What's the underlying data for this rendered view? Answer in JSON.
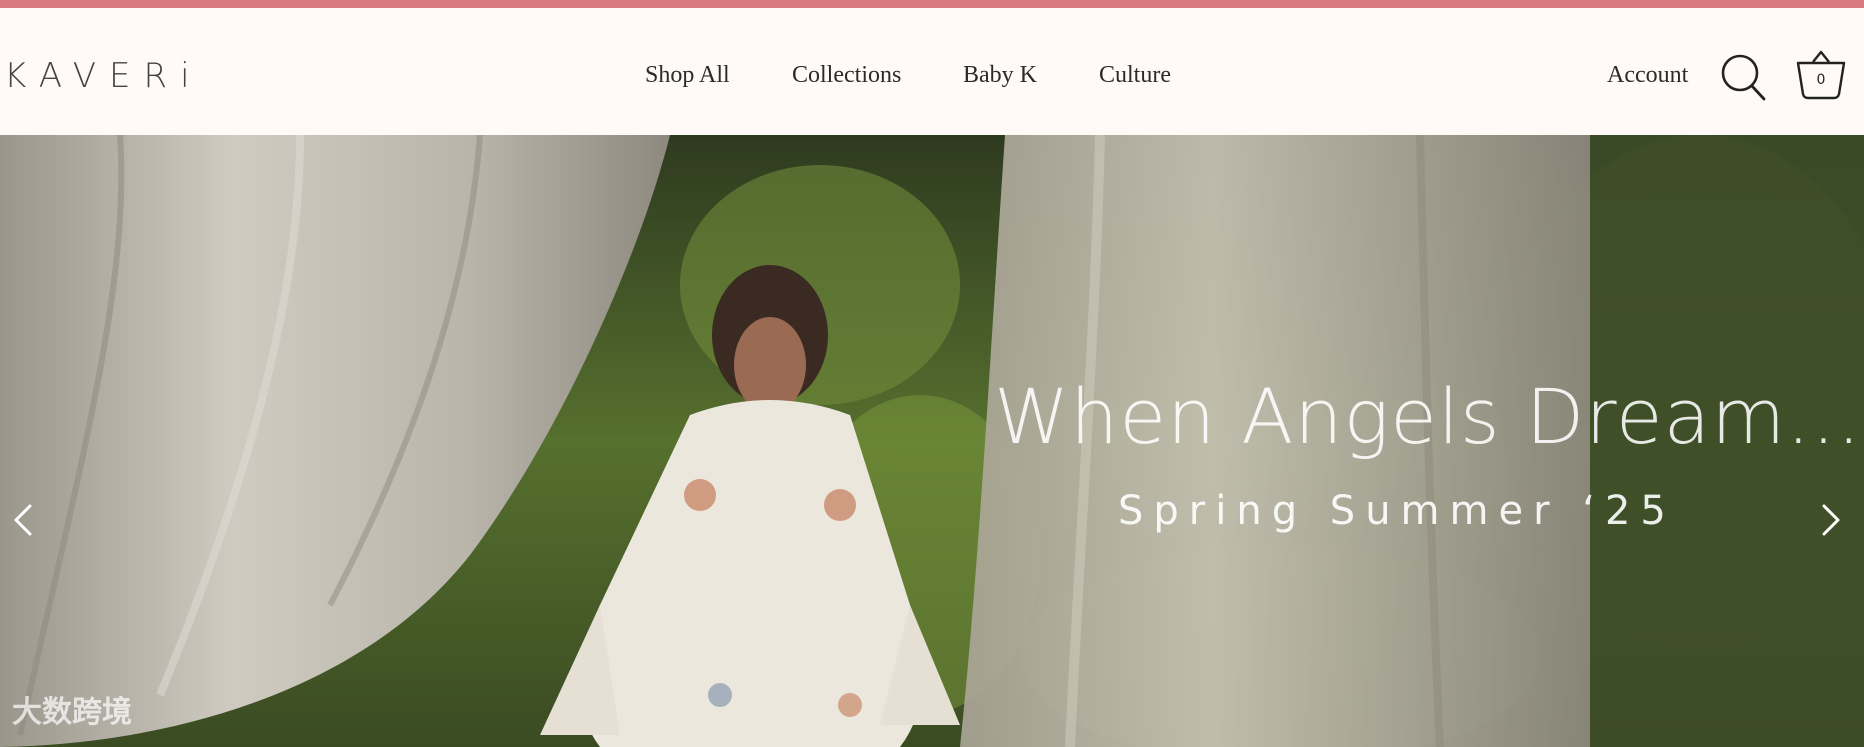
{
  "colors": {
    "top_bar": "#d97a80",
    "header_bg": "#fffaf7",
    "text": "#2b2b2b"
  },
  "brand": {
    "logo_text": "KAVERi"
  },
  "nav": {
    "items": [
      {
        "label": "Shop All"
      },
      {
        "label": "Collections"
      },
      {
        "label": "Baby K"
      },
      {
        "label": "Culture"
      }
    ]
  },
  "header_actions": {
    "account_label": "Account",
    "search_icon": "search-icon",
    "cart_icon": "basket-icon",
    "cart_count": "0"
  },
  "hero": {
    "title": "When Angels Dream...",
    "subtitle": "Spring Summer ‘25",
    "prev_icon": "chevron-left-icon",
    "next_icon": "chevron-right-icon"
  },
  "watermark": {
    "text": "大数跨境"
  }
}
